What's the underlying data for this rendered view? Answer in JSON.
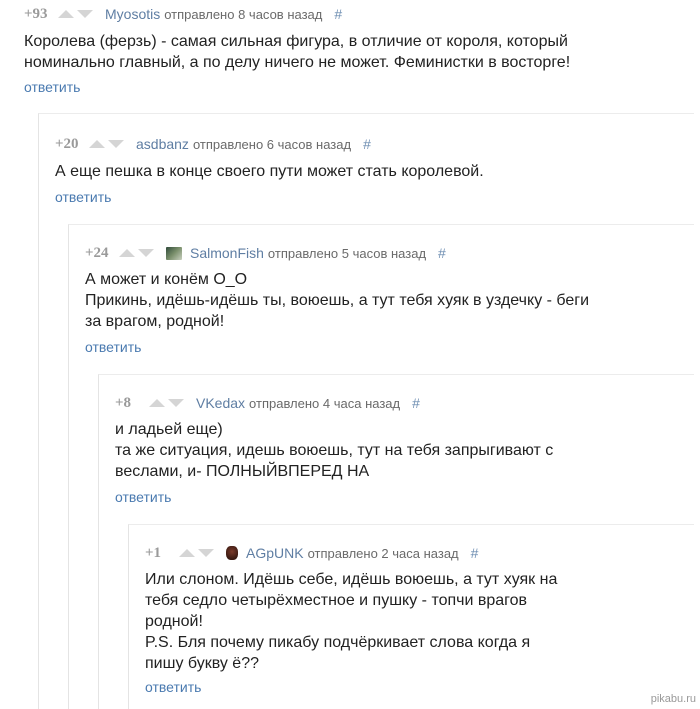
{
  "reply_label": "ответить",
  "comments": [
    {
      "score": "+93",
      "author": "Myosotis",
      "sent": "отправлено 8 часов назад",
      "permalink": "#",
      "lines": [
        "Королева (ферзь) - самая сильная фигура, в отличие от короля, который",
        "номинально главный, а по делу ничего не может. Феминистки в восторге!"
      ]
    },
    {
      "score": "+20",
      "author": "asdbanz",
      "sent": "отправлено 6 часов назад",
      "permalink": "#",
      "lines": [
        "А еще пешка в конце своего пути может стать королевой."
      ]
    },
    {
      "score": "+24",
      "author": "SalmonFish",
      "avatar": "fish-avatar-icon",
      "sent": "отправлено 5 часов назад",
      "permalink": "#",
      "lines": [
        "А может и конём О_О",
        "Прикинь, идёшь-идёшь ты, воюешь, а тут тебя хуяк в уздечку - беги",
        "за врагом, родной!"
      ]
    },
    {
      "score": "+8",
      "author": "VKedax",
      "sent": "отправлено 4 часа назад",
      "permalink": "#",
      "lines": [
        "и ладьей еще)",
        "та же ситуация, идешь воюешь, тут на тебя запрыгивают с",
        "веслами, и- ПОЛНЫЙВПЕРЕД НА"
      ]
    },
    {
      "score": "+1",
      "author": "AGpUNK",
      "avatar": "user-avatar-icon",
      "sent": "отправлено 2 часа назад",
      "permalink": "#",
      "lines": [
        "Или слоном. Идёшь себе, идёшь воюешь, а тут хуяк на",
        "тебя седло четырёхместное и пушку - топчи врагов",
        "родной!",
        "P.S. Бля почему пикабу подчёркивает слова когда я",
        "пишу букву ё??"
      ]
    }
  ],
  "watermark": "pikabu.ru"
}
